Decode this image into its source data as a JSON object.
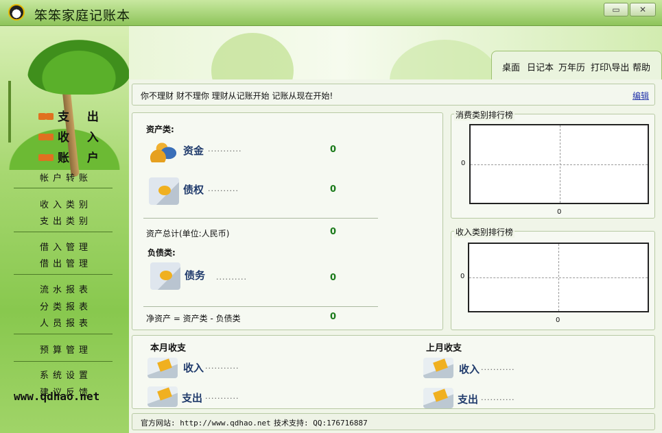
{
  "window": {
    "title": "笨笨家庭记账本",
    "minimize_label": "▭",
    "close_label": "✕"
  },
  "sidebar": {
    "main_nav": [
      "支 出",
      "收 入",
      "账 户"
    ],
    "groups": [
      [
        "帐户转账"
      ],
      [
        "收入类别",
        "支出类别"
      ],
      [
        "借入管理",
        "借出管理"
      ],
      [
        "流水报表",
        "分类报表",
        "人员报表"
      ],
      [
        "预算管理"
      ],
      [
        "系统设置",
        "建议反馈"
      ]
    ],
    "brand": "www.qdhao.net"
  },
  "toolbar": [
    "桌面",
    "日记本",
    "万年历",
    "打印\\导出",
    "帮助"
  ],
  "notice": {
    "text": "你不理财  财不理你  理财从记账开始  记账从现在开始!",
    "edit_label": "编辑"
  },
  "assets": {
    "assets_heading": "资产类:",
    "fund_label": "资金",
    "fund_dots": "...........",
    "fund_value": "0",
    "claim_label": "债权",
    "claim_dots": "..........",
    "claim_value": "0",
    "total_label": "资产总计(单位:人民币)",
    "total_value": "0",
    "liab_heading": "负债类:",
    "debt_label": "债务",
    "debt_dots": "..........",
    "debt_value": "0",
    "net_label": "净资产 = 资产类 - 负债类",
    "net_value": "0"
  },
  "charts": {
    "expense_title": "消费类别排行榜",
    "income_title": "收入类别排行榜"
  },
  "chart_data": [
    {
      "type": "bar",
      "title": "消费类别排行榜",
      "categories": [],
      "values": [],
      "xlabel": "",
      "ylabel": "",
      "x_tick_labels": [
        "0"
      ],
      "y_tick_labels": [
        "0"
      ],
      "grid": true
    },
    {
      "type": "bar",
      "title": "收入类别排行榜",
      "categories": [],
      "values": [],
      "xlabel": "",
      "ylabel": "",
      "x_tick_labels": [
        "0"
      ],
      "y_tick_labels": [
        "0"
      ],
      "grid": true
    }
  ],
  "monthly": {
    "this_month_heading": "本月收支",
    "last_month_heading": "上月收支",
    "income_label": "收入",
    "expense_label": "支出",
    "dots": "...........",
    "dots_long": "..........."
  },
  "status": {
    "site": "官方网站: http://www.qdhao.net",
    "support": "技术支持: QQ:176716887"
  }
}
